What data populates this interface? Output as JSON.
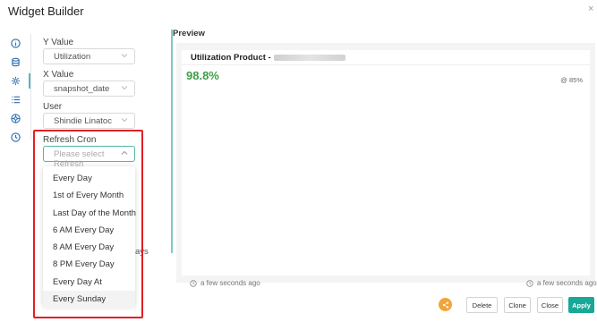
{
  "window": {
    "title": "Widget Builder",
    "close_glyph": "×"
  },
  "sidebar": {
    "icons": [
      {
        "name": "info-icon"
      },
      {
        "name": "database-icon"
      },
      {
        "name": "settings-icon",
        "active": true
      },
      {
        "name": "list-icon"
      },
      {
        "name": "palette-icon"
      },
      {
        "name": "clock-icon"
      }
    ]
  },
  "form": {
    "y_value": {
      "label": "Y Value",
      "value": "Utilization"
    },
    "x_value": {
      "label": "X Value",
      "value": "snapshot_date"
    },
    "user": {
      "label": "User",
      "value": "Shindie Linatoc"
    },
    "refresh_cron": {
      "label": "Refresh Cron",
      "placeholder": "Please select Refresh",
      "options": [
        "Every Day",
        "1st of Every Month",
        "Last Day of the Month",
        "6 AM Every Day",
        "8 AM Every Day",
        "8 PM Every Day",
        "Every Day At",
        "Every Sunday"
      ],
      "hovered": "Every Sunday"
    },
    "obscured_text_fragment": "ays"
  },
  "preview": {
    "label": "Preview",
    "card": {
      "title": "Utilization Product -",
      "value": "98.8%",
      "target": "@ 85%"
    },
    "footer_left": "a few seconds ago",
    "footer_right": "a few seconds ago"
  },
  "actions": {
    "delete": "Delete",
    "clone": "Clone",
    "close": "Close",
    "apply": "Apply"
  },
  "colors": {
    "accent": "#19a797",
    "value_green": "#3b9e44",
    "highlight_red": "#e21f26",
    "share_orange": "#f2a43a"
  }
}
